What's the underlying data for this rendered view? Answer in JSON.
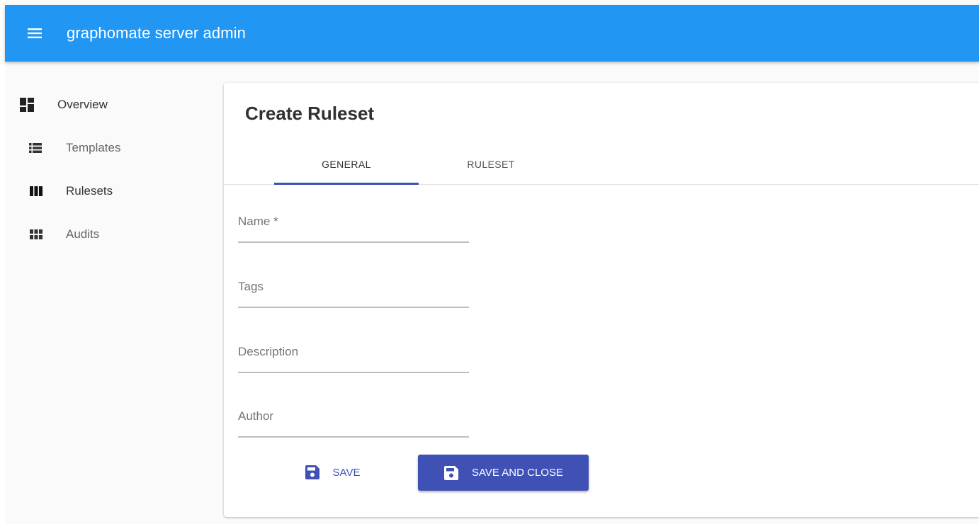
{
  "appbar": {
    "title": "graphomate server admin",
    "menu_icon": "menu-icon",
    "color": "#2196f3"
  },
  "sidebar": {
    "items": [
      {
        "label": "Overview",
        "icon": "dashboard-icon"
      },
      {
        "label": "Templates",
        "icon": "list-icon"
      },
      {
        "label": "Rulesets",
        "icon": "view-column-icon"
      },
      {
        "label": "Audits",
        "icon": "view-module-icon"
      }
    ]
  },
  "main": {
    "title": "Create Ruleset",
    "tabs": [
      {
        "label": "GENERAL",
        "active": true
      },
      {
        "label": "RULESET",
        "active": false
      }
    ],
    "fields": [
      {
        "label": "Name *",
        "value": ""
      },
      {
        "label": "Tags",
        "value": ""
      },
      {
        "label": "Description",
        "value": ""
      },
      {
        "label": "Author",
        "value": ""
      }
    ],
    "buttons": {
      "save": "SAVE",
      "save_and_close": "SAVE AND CLOSE",
      "icon": "save-icon"
    }
  },
  "colors": {
    "primary": "#2196f3",
    "accent": "#3f51b5"
  }
}
